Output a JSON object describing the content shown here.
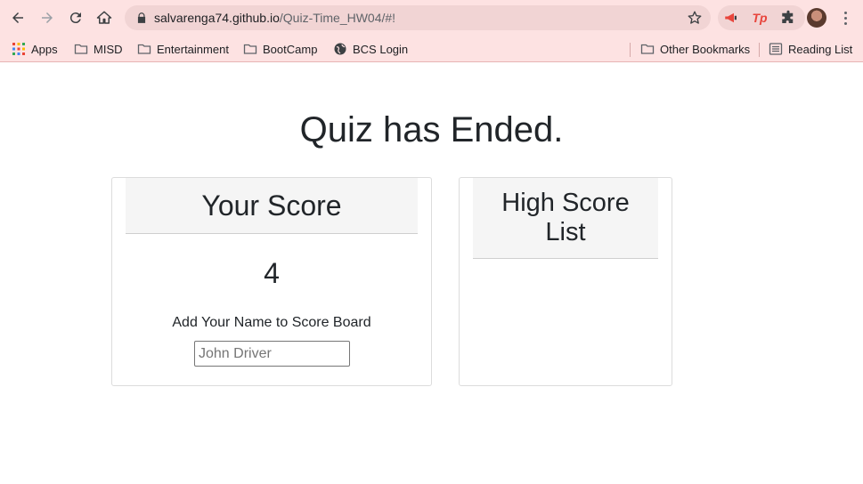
{
  "browser": {
    "url_host": "salvarenga74.github.io",
    "url_path": "/Quiz-Time_HW04/#!",
    "bookmarks": [
      {
        "label": "Apps",
        "icon": "apps-grid-icon"
      },
      {
        "label": "MISD",
        "icon": "folder-icon"
      },
      {
        "label": "Entertainment",
        "icon": "folder-icon"
      },
      {
        "label": "BootCamp",
        "icon": "folder-icon"
      },
      {
        "label": "BCS Login",
        "icon": "globe-icon"
      },
      {
        "label": "Other Bookmarks",
        "icon": "folder-icon"
      },
      {
        "label": "Reading List",
        "icon": "reading-list-icon"
      }
    ],
    "extensions": [
      {
        "name": "megaphone-extension-icon",
        "color": "#e8453c"
      },
      {
        "name": "tp-extension-icon",
        "label": "Tp",
        "color": "#e8453c"
      },
      {
        "name": "puzzle-extensions-icon",
        "color": "#5f6368"
      }
    ]
  },
  "page": {
    "title": "Quiz has Ended.",
    "score_card": {
      "header": "Your Score",
      "score": "4",
      "name_label": "Add Your Name to Score Board",
      "name_input": {
        "value": "",
        "placeholder": "John Driver"
      }
    },
    "high_score_card": {
      "header": "High Score List",
      "entries": []
    }
  },
  "colors": {
    "chrome_bg": "#fde2e2",
    "omnibox_bg": "#f1d4d4",
    "text": "#212529",
    "card_header_bg": "#f5f5f5"
  }
}
